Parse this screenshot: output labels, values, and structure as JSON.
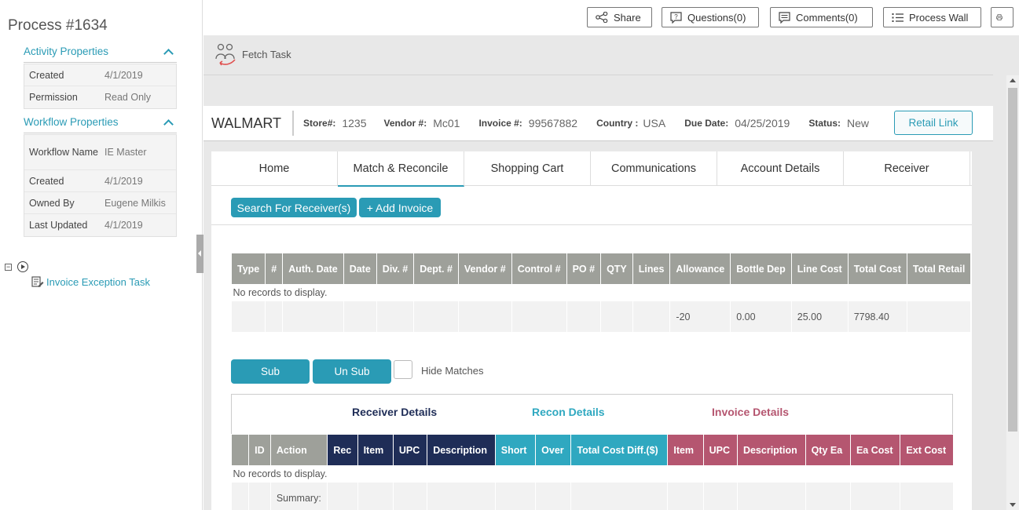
{
  "left_panel": {
    "process_title": "Process #1634",
    "activity": {
      "heading": "Activity Properties",
      "rows": [
        {
          "label": "Created",
          "value": "4/1/2019"
        },
        {
          "label": "Permission",
          "value": "Read Only"
        }
      ]
    },
    "workflow": {
      "heading": "Workflow Properties",
      "rows": [
        {
          "label": "Workflow Name",
          "value": "IE Master"
        },
        {
          "label": "Created",
          "value": "4/1/2019"
        },
        {
          "label": "Owned By",
          "value": "Eugene Milkis"
        },
        {
          "label": "Last Updated",
          "value": "4/1/2019"
        }
      ]
    },
    "tree_task": "Invoice Exception Task"
  },
  "toolbar": {
    "share": "Share",
    "questions": "Questions(0)",
    "comments": "Comments(0)",
    "process_wall": "Process Wall"
  },
  "fetch_task": "Fetch Task",
  "info": {
    "brand": "WALMART",
    "store_label": "Store#:",
    "store": "1235",
    "vendor_label": "Vendor #:",
    "vendor": "Mc01",
    "invoice_label": "Invoice #:",
    "invoice": "99567882",
    "country_label": "Country :",
    "country": "USA",
    "due_label": "Due Date:",
    "due": "04/25/2019",
    "status_label": "Status:",
    "status": "New",
    "retail_link": "Retail Link"
  },
  "tabs": [
    "Home",
    "Match & Reconcile",
    "Shopping Cart",
    "Communications",
    "Account Details",
    "Receiver"
  ],
  "actions": {
    "search_receivers": "Search For Receiver(s)",
    "add_invoice": "+ Add Invoice",
    "sub": "Sub",
    "unsub": "Un Sub",
    "hide_matches": "Hide Matches"
  },
  "invoice_grid": {
    "columns": [
      "Type",
      "#",
      "Auth. Date",
      "Date",
      "Div. #",
      "Dept. #",
      "Vendor #",
      "Control #",
      "PO #",
      "QTY",
      "Lines",
      "Allowance",
      "Bottle Dep",
      "Line Cost",
      "Total Cost",
      "Total Retail"
    ],
    "empty_message": "No records to display.",
    "totals": [
      "",
      "",
      "",
      "",
      "",
      "",
      "",
      "",
      "",
      "",
      "",
      "-20",
      "0.00",
      "25.00",
      "7798.40",
      ""
    ]
  },
  "details": {
    "receiver": "Receiver Details",
    "recon": "Recon Details",
    "invoice": "Invoice Details",
    "columns": [
      "",
      "ID",
      "Action",
      "Rec",
      "Item",
      "UPC",
      "Description",
      "Short",
      "Over",
      "Total Cost Diff.($)",
      "Item",
      "UPC",
      "Description",
      "Qty Ea",
      "Ea Cost",
      "Ext Cost"
    ],
    "empty_message": "No records to display.",
    "summary_label": "Summary:"
  },
  "colors": {
    "accent": "#2a9bb5",
    "grid_header": "#9ea09a",
    "receiver": "#1f2d57",
    "recon": "#2fa8c0",
    "invoice": "#b55670"
  }
}
